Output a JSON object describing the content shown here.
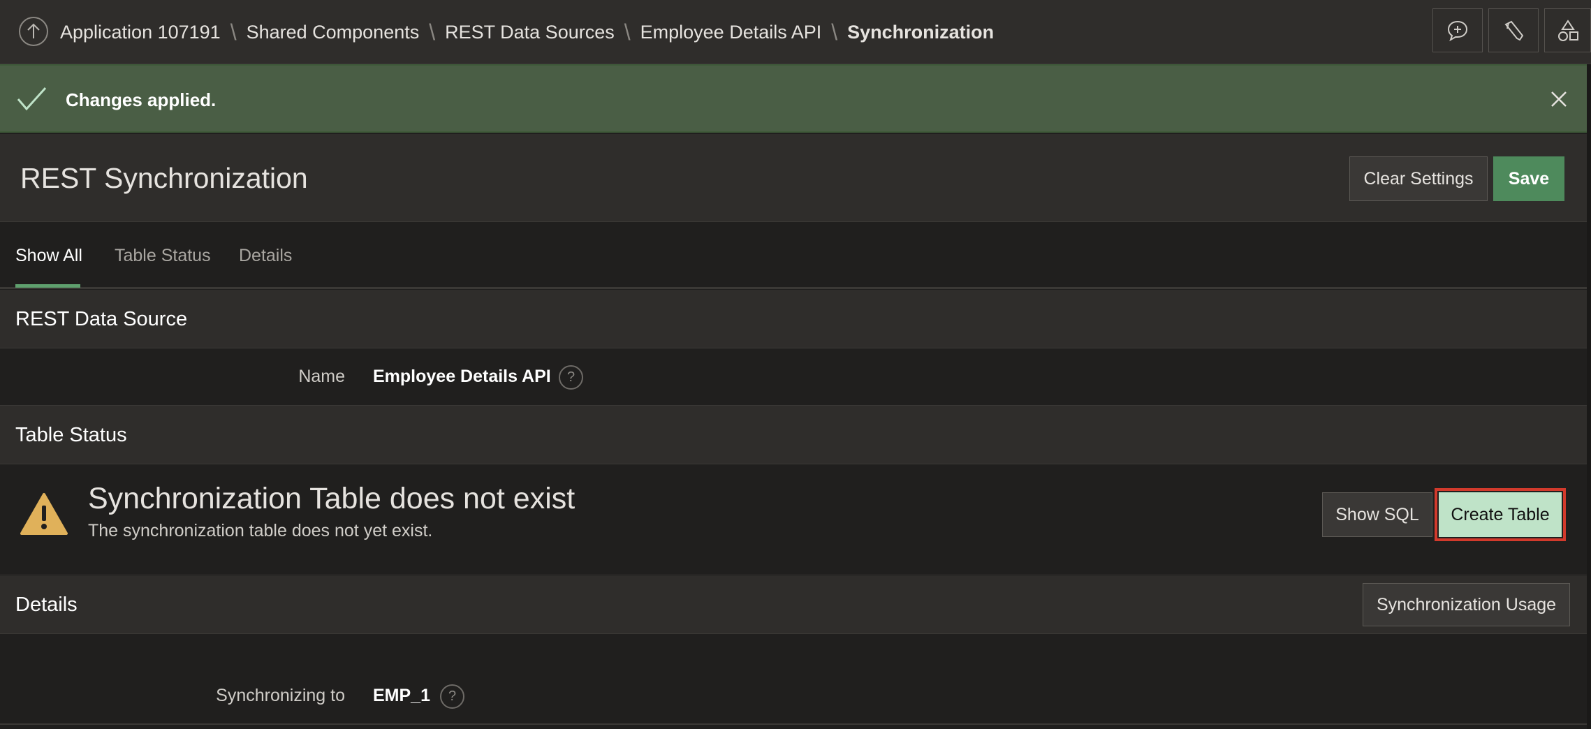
{
  "breadcrumb": {
    "items": [
      "Application 107191",
      "Shared Components",
      "REST Data Sources",
      "Employee Details API"
    ],
    "current": "Synchronization"
  },
  "toolbar": {
    "icons": [
      "feedback-icon",
      "developer-tools-icon",
      "shared-components-icon"
    ]
  },
  "alert": {
    "message": "Changes applied.",
    "status_color": "#4a5e45"
  },
  "page": {
    "title": "REST Synchronization",
    "clear_label": "Clear Settings",
    "save_label": "Save"
  },
  "tabs": [
    {
      "label": "Show All",
      "active": true
    },
    {
      "label": "Table Status",
      "active": false
    },
    {
      "label": "Details",
      "active": false
    }
  ],
  "rest_data_source": {
    "heading": "REST Data Source",
    "name_label": "Name",
    "name_value": "Employee Details API",
    "help": "?"
  },
  "table_status": {
    "heading": "Table Status",
    "title": "Synchronization Table does not exist",
    "description": "The synchronization table does not yet exist.",
    "show_sql_label": "Show SQL",
    "create_table_label": "Create Table"
  },
  "details": {
    "heading": "Details",
    "usage_label": "Synchronization Usage",
    "sync_label": "Synchronizing to",
    "sync_value": "EMP_1",
    "help": "?"
  },
  "colors": {
    "accent": "#4e8a5c",
    "warning": "#e0b15a",
    "highlight": "#d23a2c"
  }
}
